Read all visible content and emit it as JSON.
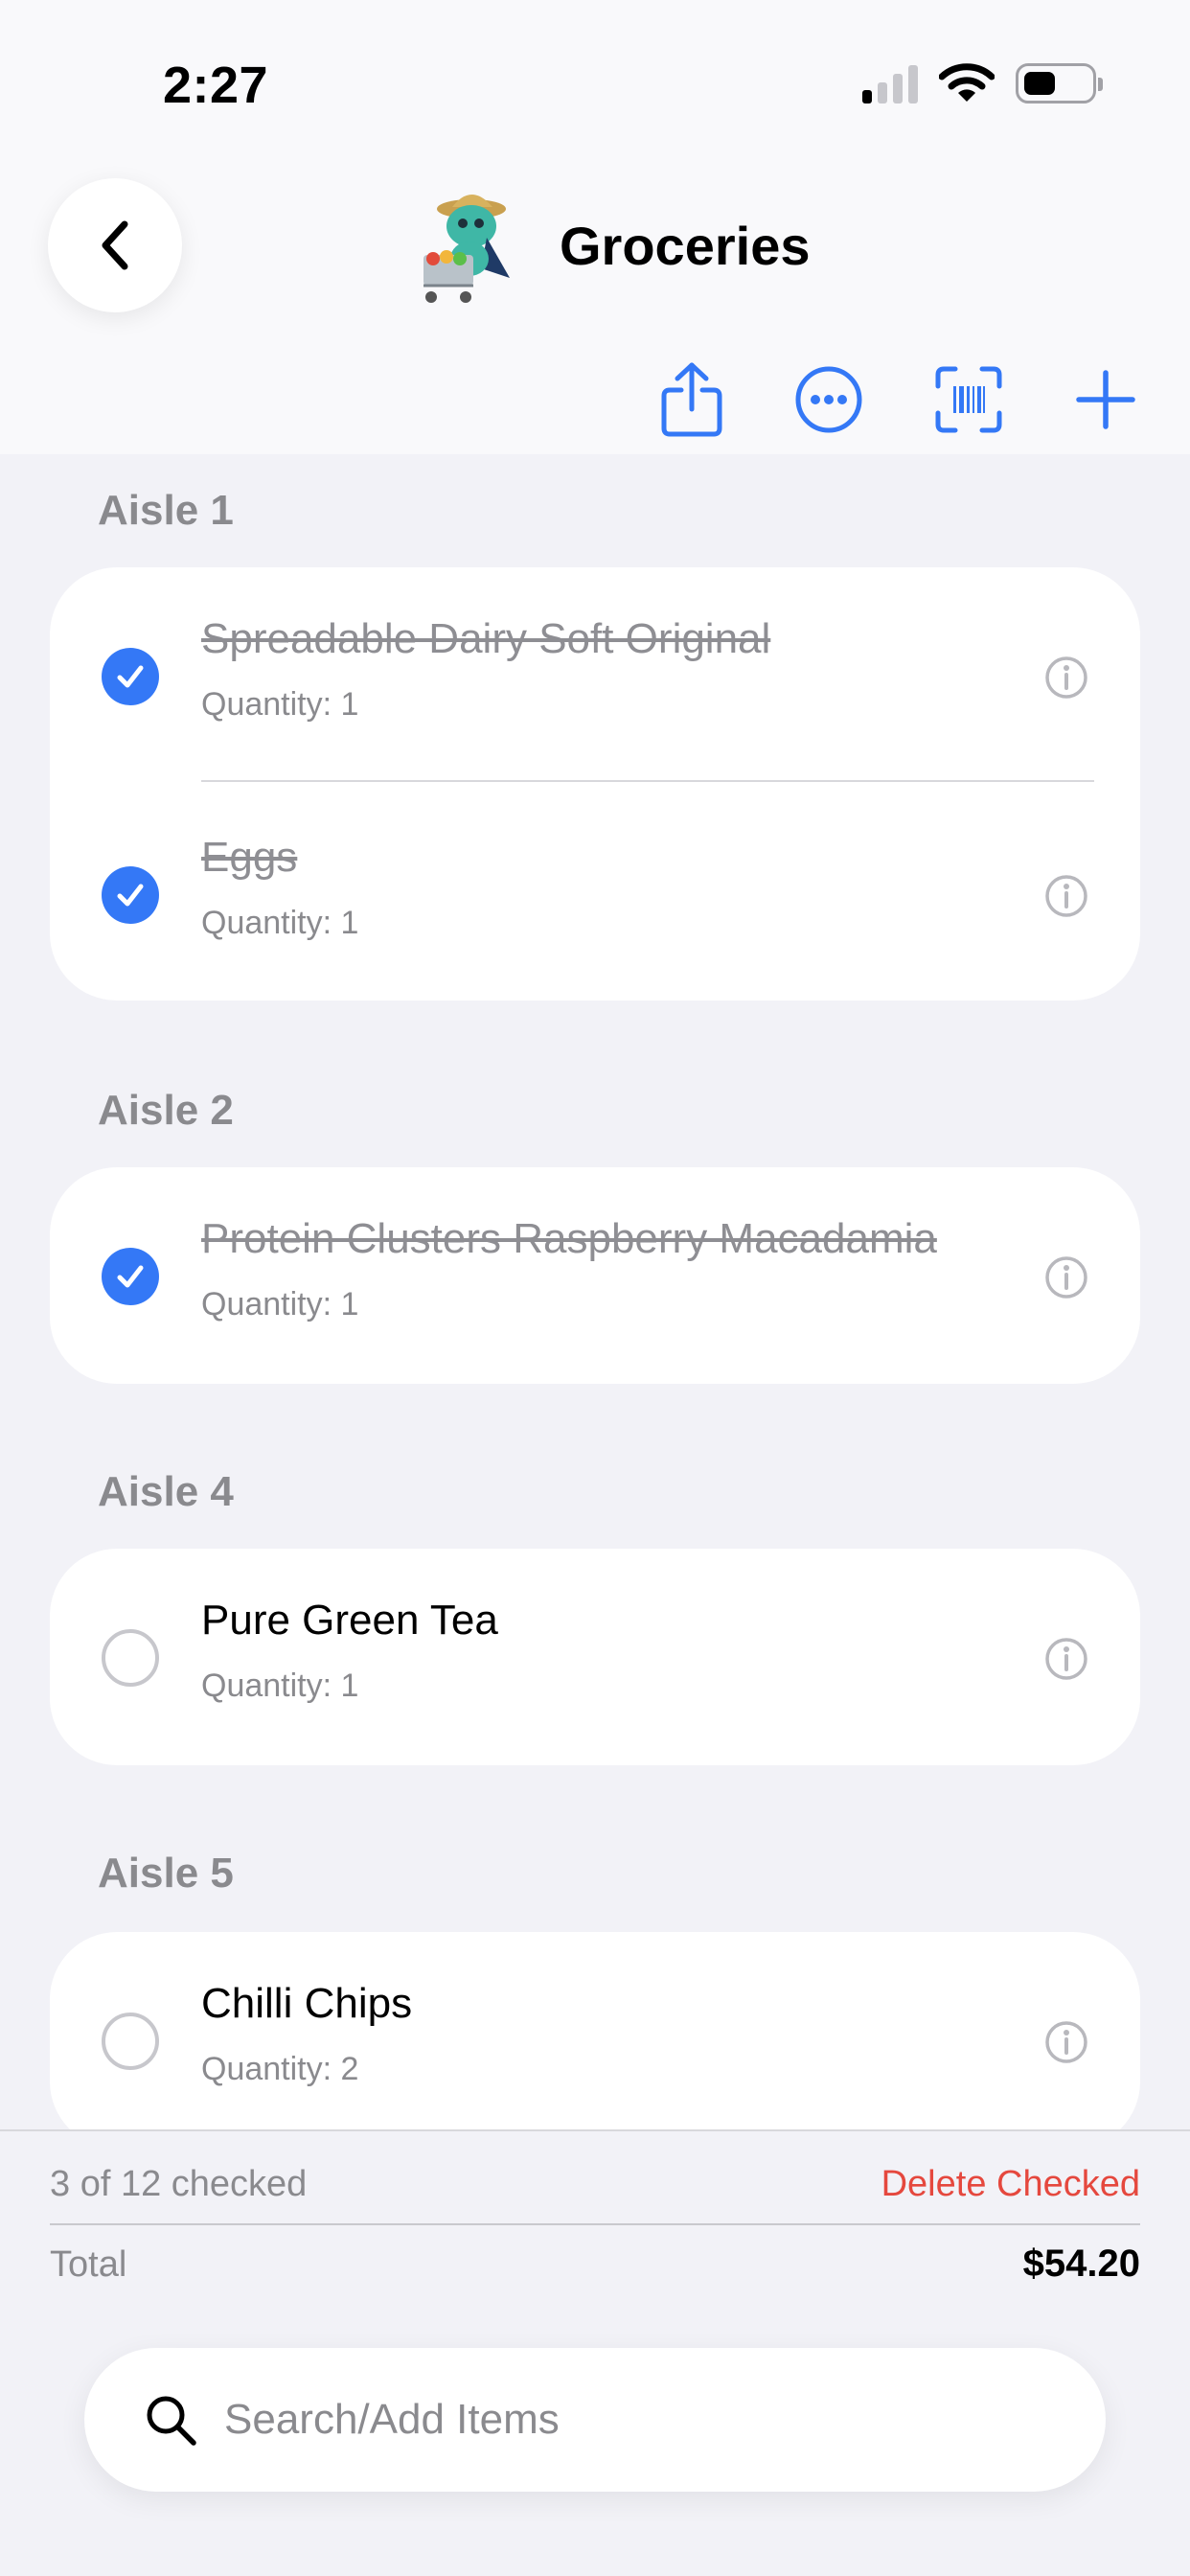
{
  "status_bar": {
    "time": "2:27",
    "icons": [
      "cellular-signal-icon",
      "wifi-icon",
      "battery-icon"
    ]
  },
  "header": {
    "title": "Groceries",
    "mascot": "grocery-mascot-icon"
  },
  "toolbar": {
    "icons": [
      "share-icon",
      "more-icon",
      "barcode-scan-icon",
      "add-icon"
    ],
    "accent": "#3478f6"
  },
  "sections": [
    {
      "label": "Aisle 1",
      "items": [
        {
          "name": "Spreadable Dairy Soft Original",
          "quantity": "Quantity: 1",
          "checked": true
        },
        {
          "name": "Eggs",
          "quantity": "Quantity: 1",
          "checked": true
        }
      ]
    },
    {
      "label": "Aisle 2",
      "items": [
        {
          "name": "Protein Clusters Raspberry Macadamia",
          "quantity": "Quantity: 1",
          "checked": true
        }
      ]
    },
    {
      "label": "Aisle 4",
      "items": [
        {
          "name": "Pure Green Tea",
          "quantity": "Quantity: 1",
          "checked": false
        }
      ]
    },
    {
      "label": "Aisle 5",
      "items": [
        {
          "name": "Chilli Chips",
          "quantity": "Quantity: 2",
          "checked": false
        }
      ]
    }
  ],
  "summary": {
    "checked_text": "3 of 12 checked",
    "delete_label": "Delete Checked",
    "total_label": "Total",
    "total_value": "$54.20"
  },
  "search": {
    "placeholder": "Search/Add Items",
    "value": ""
  },
  "colors": {
    "accent": "#3478f6",
    "destructive": "#e5483e",
    "secondary_text": "#8a8a8e"
  }
}
